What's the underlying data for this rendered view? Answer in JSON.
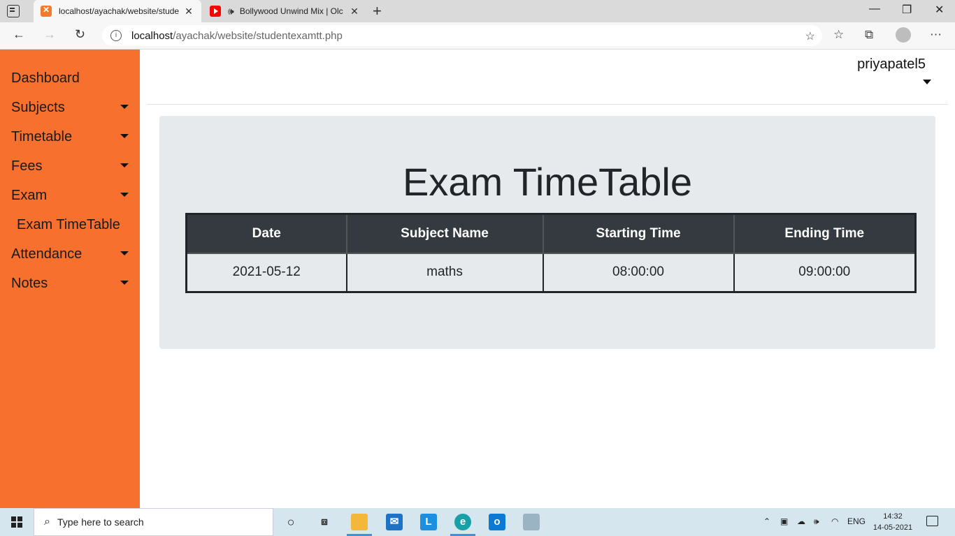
{
  "browser": {
    "tabs": [
      {
        "title": "localhost/ayachak/website/stude",
        "icon": "xampp-icon"
      },
      {
        "title": "Bollywood Unwind Mix | Olc",
        "icon": "youtube-icon"
      }
    ],
    "url_host": "localhost",
    "url_path": "/ayachak/website/studentexamtt.php"
  },
  "sidebar": {
    "items": [
      {
        "label": "Dashboard",
        "has_caret": false
      },
      {
        "label": "Subjects",
        "has_caret": true
      },
      {
        "label": "Timetable",
        "has_caret": true
      },
      {
        "label": "Fees",
        "has_caret": true
      },
      {
        "label": "Exam",
        "has_caret": true
      },
      {
        "label": "Exam TimeTable",
        "has_caret": false
      },
      {
        "label": "Attendance",
        "has_caret": true
      },
      {
        "label": "Notes",
        "has_caret": true
      }
    ]
  },
  "header": {
    "username": "priyapatel5"
  },
  "main": {
    "title": "Exam TimeTable",
    "columns": [
      "Date",
      "Subject Name",
      "Starting Time",
      "Ending Time"
    ],
    "rows": [
      [
        "2021-05-12",
        "maths",
        "08:00:00",
        "09:00:00"
      ]
    ]
  },
  "taskbar": {
    "search_placeholder": "Type here to search",
    "language": "ENG",
    "time": "14:32",
    "date": "14-05-2021"
  },
  "colors": {
    "sidebar": "#f7702e",
    "table_header": "#343a40",
    "card": "#e7eaed"
  }
}
